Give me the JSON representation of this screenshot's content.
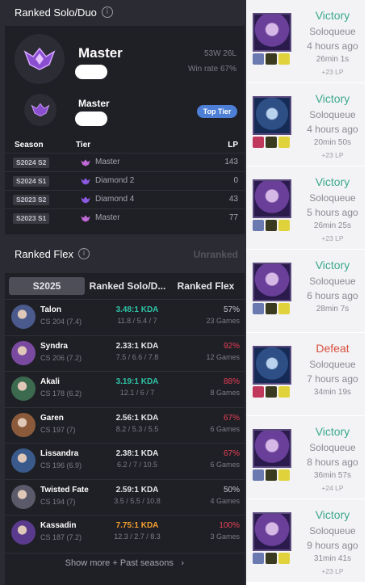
{
  "solo": {
    "title": "Ranked Solo/Duo",
    "tier": "Master",
    "record": "53W 26L",
    "winrate": "Win rate 67%",
    "secondary_tier": "Master",
    "top_tier_label": "Top Tier",
    "headers": {
      "season": "Season",
      "tier": "Tier",
      "lp": "LP"
    },
    "seasons": [
      {
        "season": "S2024 S2",
        "tier": "Master",
        "lp": "143",
        "icon": "master-emblem-icon"
      },
      {
        "season": "S2024 S1",
        "tier": "Diamond 2",
        "lp": "0",
        "icon": "diamond-emblem-icon"
      },
      {
        "season": "S2023 S2",
        "tier": "Diamond 4",
        "lp": "43",
        "icon": "diamond-emblem-icon"
      },
      {
        "season": "S2023 S1",
        "tier": "Master",
        "lp": "77",
        "icon": "master-emblem-icon"
      }
    ]
  },
  "flex": {
    "title": "Ranked Flex",
    "status": "Unranked"
  },
  "tabs": [
    "S2025",
    "Ranked Solo/D...",
    "Ranked Flex"
  ],
  "champions": [
    {
      "name": "Talon",
      "cs": "CS 204 (7.4)",
      "kda": "3.48:1 KDA",
      "kda_detail": "11.8 / 5.4 / 7",
      "winrate": "57%",
      "games": "23 Games",
      "kda_color": "#2ec4a6",
      "wr_color": "#c8c8d0",
      "avatar_color": "#4a5a8c"
    },
    {
      "name": "Syndra",
      "cs": "CS 206 (7.2)",
      "kda": "2.33:1 KDA",
      "kda_detail": "7.5 / 6.6 / 7.8",
      "winrate": "92%",
      "games": "12 Games",
      "kda_color": "#e5e5ea",
      "wr_color": "#e84057",
      "avatar_color": "#7a4aa0"
    },
    {
      "name": "Akali",
      "cs": "CS 178 (6.2)",
      "kda": "3.19:1 KDA",
      "kda_detail": "12.1 / 6 / 7",
      "winrate": "88%",
      "games": "8 Games",
      "kda_color": "#2ec4a6",
      "wr_color": "#e84057",
      "avatar_color": "#3c6a4e"
    },
    {
      "name": "Garen",
      "cs": "CS 197 (7)",
      "kda": "2.56:1 KDA",
      "kda_detail": "8.2 / 5.3 / 5.5",
      "winrate": "67%",
      "games": "6 Games",
      "kda_color": "#e5e5ea",
      "wr_color": "#e84057",
      "avatar_color": "#8a5a3a"
    },
    {
      "name": "Lissandra",
      "cs": "CS 196 (6.9)",
      "kda": "2.38:1 KDA",
      "kda_detail": "6.2 / 7 / 10.5",
      "winrate": "67%",
      "games": "6 Games",
      "kda_color": "#e5e5ea",
      "wr_color": "#e84057",
      "avatar_color": "#3a5a8c"
    },
    {
      "name": "Twisted Fate",
      "cs": "CS 194 (7)",
      "kda": "2.59:1 KDA",
      "kda_detail": "3.5 / 5.5 / 10.8",
      "winrate": "50%",
      "games": "4 Games",
      "kda_color": "#e5e5ea",
      "wr_color": "#c8c8d0",
      "avatar_color": "#5a5a6a"
    },
    {
      "name": "Kassadin",
      "cs": "CS 187 (7.2)",
      "kda": "7.75:1 KDA",
      "kda_detail": "12.3 / 2.7 / 8.3",
      "winrate": "100%",
      "games": "3 Games",
      "kda_color": "#f2a030",
      "wr_color": "#e84057",
      "avatar_color": "#5a3a8c"
    }
  ],
  "show_more": "Show more + Past seasons",
  "matches": [
    {
      "result": "Victory",
      "queue": "Soloqueue",
      "ago": "4 hours ago",
      "duration": "26min 1s",
      "lp": "+23 LP",
      "win": true,
      "champ_icon": "syndra-portrait-icon"
    },
    {
      "result": "Victory",
      "queue": "Soloqueue",
      "ago": "4 hours ago",
      "duration": "20min 50s",
      "lp": "+23 LP",
      "win": true,
      "champ_icon": "lissandra-portrait-icon"
    },
    {
      "result": "Victory",
      "queue": "Soloqueue",
      "ago": "5 hours ago",
      "duration": "26min 25s",
      "lp": "+23 LP",
      "win": true,
      "champ_icon": "syndra-portrait-icon"
    },
    {
      "result": "Victory",
      "queue": "Soloqueue",
      "ago": "6 hours ago",
      "duration": "28min 7s",
      "lp": "",
      "win": true,
      "champ_icon": "syndra-portrait-icon"
    },
    {
      "result": "Defeat",
      "queue": "Soloqueue",
      "ago": "7 hours ago",
      "duration": "34min 19s",
      "lp": "",
      "win": false,
      "champ_icon": "lissandra-portrait-icon"
    },
    {
      "result": "Victory",
      "queue": "Soloqueue",
      "ago": "8 hours ago",
      "duration": "36min 57s",
      "lp": "+24 LP",
      "win": true,
      "champ_icon": "syndra-portrait-icon"
    },
    {
      "result": "Victory",
      "queue": "Soloqueue",
      "ago": "9 hours ago",
      "duration": "31min 41s",
      "lp": "+23 LP",
      "win": true,
      "champ_icon": "syndra-portrait-icon"
    }
  ],
  "colors": {
    "victory": "#3aa88a",
    "defeat": "#d8503c",
    "accent": "#4d7fd6"
  }
}
